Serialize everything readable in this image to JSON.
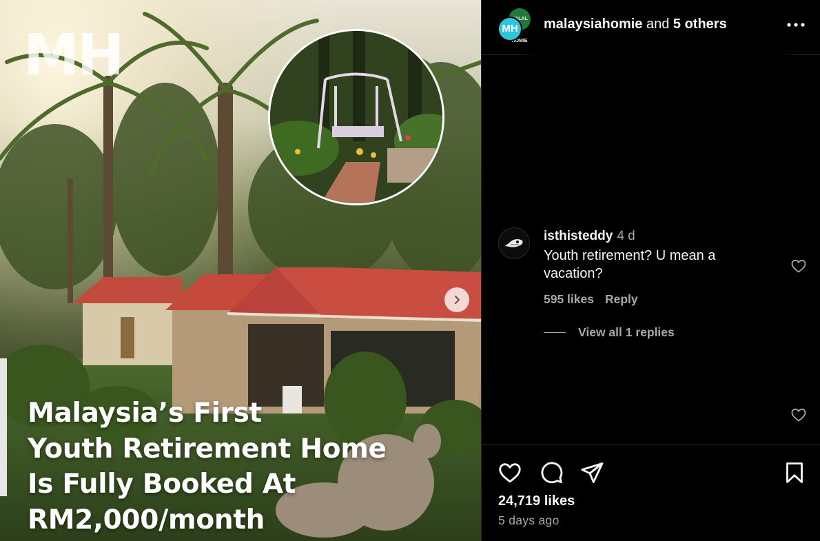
{
  "post": {
    "watermark": "MH",
    "headline_lines": [
      "Malaysia’s First",
      "Youth Retirement Home",
      "Is Fully Booked At",
      "RM2,000/month"
    ]
  },
  "header": {
    "avatar_back_text": "HALAL HOMIE",
    "avatar_front_text": "MH",
    "username": "malaysiahomie",
    "joiner": " and ",
    "others": "5 others",
    "more_icon": "more-horizontal-icon"
  },
  "comment": {
    "username": "isthisteddy",
    "time": "4 d",
    "text": "Youth retirement? U mean a vacation?",
    "likes": "595 likes",
    "reply_label": "Reply",
    "view_replies": "View all 1 replies"
  },
  "footer": {
    "likes": "24,719 likes",
    "age": "5 days ago"
  },
  "colors": {
    "panel_bg": "#000000",
    "text_primary": "#f5f5f5",
    "text_secondary": "#a8a8a8",
    "divider": "#262626",
    "avatar_accent": "#2fc6db"
  }
}
